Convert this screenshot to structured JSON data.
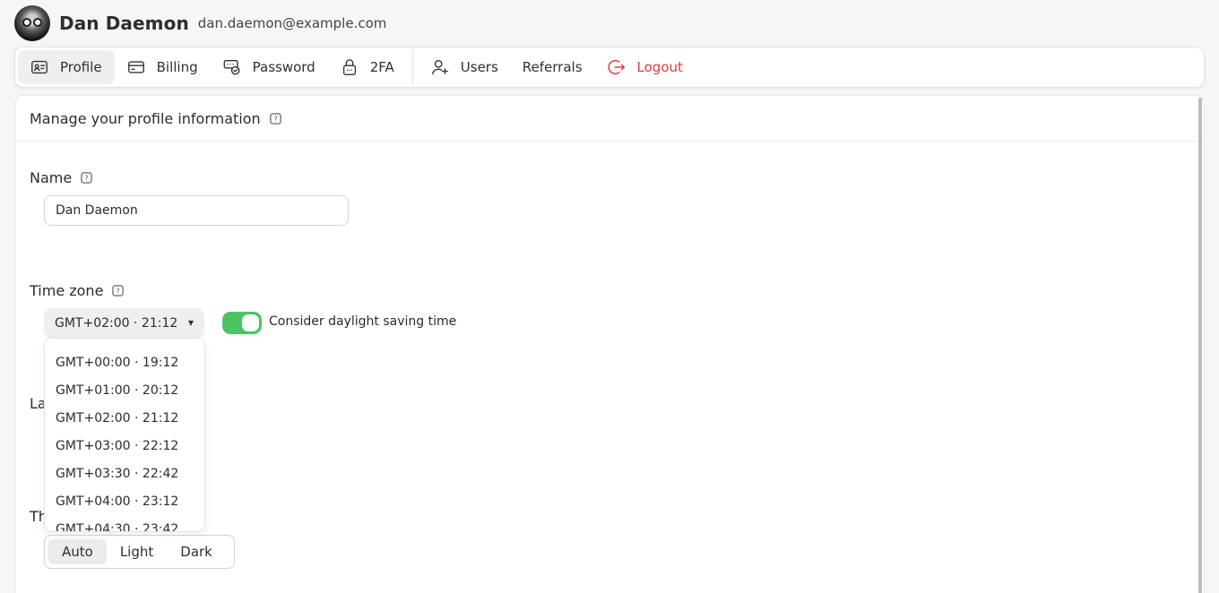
{
  "user": {
    "name": "Dan Daemon",
    "email": "dan.daemon@example.com"
  },
  "nav": {
    "items": [
      {
        "label": "Profile",
        "icon": "id-card-icon"
      },
      {
        "label": "Billing",
        "icon": "credit-card-icon"
      },
      {
        "label": "Password",
        "icon": "password-icon"
      },
      {
        "label": "2FA",
        "icon": "lock-icon"
      },
      {
        "label": "Users",
        "icon": "user-plus-icon"
      },
      {
        "label": "Referrals",
        "icon": ""
      },
      {
        "label": "Logout",
        "icon": "logout-icon"
      }
    ],
    "active": "Profile",
    "logout_color": "#e5383b"
  },
  "panel": {
    "title": "Manage your profile information"
  },
  "name_field": {
    "label": "Name",
    "value": "Dan Daemon"
  },
  "timezone": {
    "label": "Time zone",
    "selected": "GMT+02:00 · 21:12",
    "daylight_label": "Consider daylight saving time",
    "daylight_enabled": true,
    "toggle_color": "#4cc463",
    "options": [
      "GMT+00:00 · 19:12",
      "GMT+01:00 · 20:12",
      "GMT+02:00 · 21:12",
      "GMT+03:00 · 22:12",
      "GMT+03:30 · 22:42",
      "GMT+04:00 · 23:12",
      "GMT+04:30 · 23:42"
    ]
  },
  "language": {
    "label_partial": "La"
  },
  "theme": {
    "label_partial": "Th",
    "options": [
      "Auto",
      "Light",
      "Dark"
    ],
    "selected": "Auto"
  }
}
